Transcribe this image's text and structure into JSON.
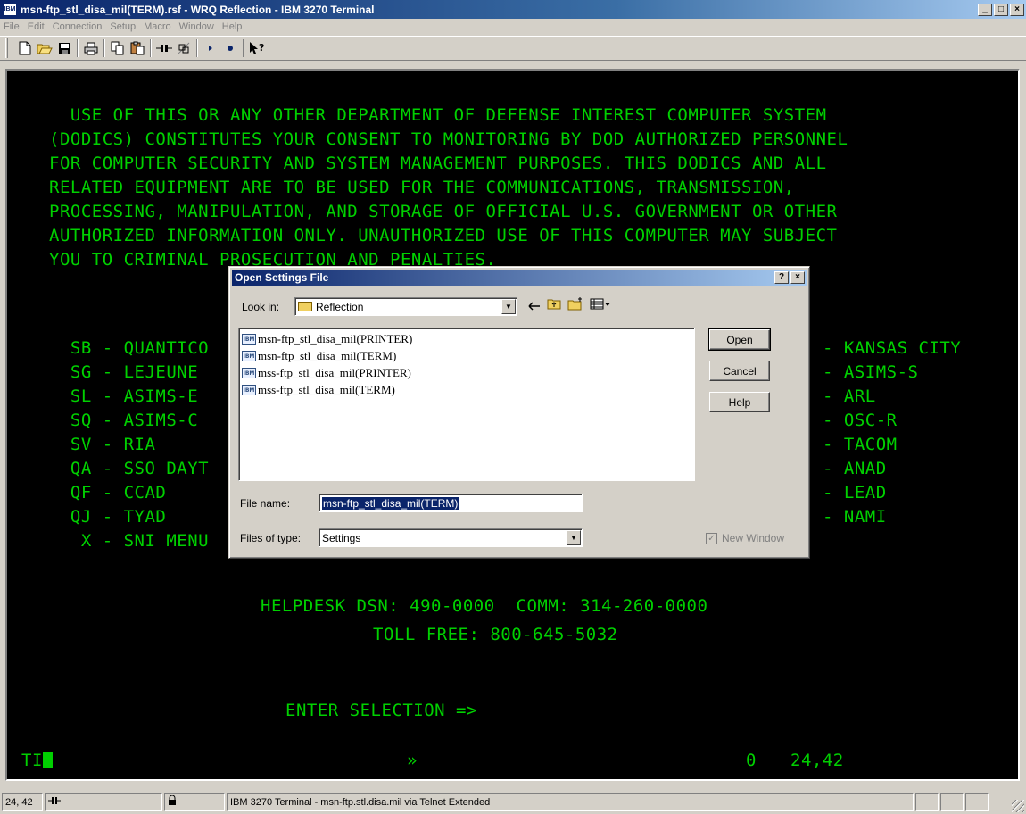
{
  "window": {
    "app_icon": "IBM",
    "title": "msn-ftp_stl_disa_mil(TERM).rsf - WRQ Reflection - IBM 3270 Terminal",
    "min_label": "_",
    "max_label": "□",
    "close_label": "×"
  },
  "menu": [
    "File",
    "Edit",
    "Connection",
    "Setup",
    "Macro",
    "Window",
    "Help"
  ],
  "toolbar": {
    "icons": [
      "new-icon",
      "open-icon",
      "save-icon",
      "print-icon",
      "copy-icon",
      "paste-icon",
      "connect-icon",
      "disconnect-icon",
      "play-macro-icon",
      "record-macro-icon",
      "context-help-icon"
    ]
  },
  "terminal": {
    "banner": [
      "  USE OF THIS OR ANY OTHER DEPARTMENT OF DEFENSE INTEREST COMPUTER SYSTEM",
      "(DODICS) CONSTITUTES YOUR CONSENT TO MONITORING BY DOD AUTHORIZED PERSONNEL",
      "FOR COMPUTER SECURITY AND SYSTEM MANAGEMENT PURPOSES. THIS DODICS AND ALL",
      "RELATED EQUIPMENT ARE TO BE USED FOR THE COMMUNICATIONS, TRANSMISSION,",
      "PROCESSING, MANIPULATION, AND STORAGE OF OFFICIAL U.S. GOVERNMENT OR OTHER",
      "AUTHORIZED INFORMATION ONLY. UNAUTHORIZED USE OF THIS COMPUTER MAY SUBJECT",
      "YOU TO CRIMINAL PROSECUTION AND PENALTIES."
    ],
    "left_menu": [
      "  SB - QUANTICO",
      "  SG - LEJEUNE",
      "  SL - ASIMS-E",
      "  SQ - ASIMS-C",
      "  SV - RIA",
      "  QA - SSO DAYT",
      "  QF - CCAD",
      "  QJ - TYAD",
      "   X - SNI MENU"
    ],
    "right_menu": [
      "- KANSAS CITY",
      "- ASIMS-S",
      "- ARL",
      "- OSC-R",
      "- TACOM",
      "- ANAD",
      "- LEAD",
      "- NAMI"
    ],
    "helpdesk": "HELPDESK DSN: 490-0000  COMM: 314-260-0000",
    "tollfree": "TOLL FREE: 800-645-5032",
    "prompt": "ENTER SELECTION =>",
    "status_left": "TI",
    "status_mid": "»",
    "status_o": "0",
    "status_pos": "24,42"
  },
  "dialog": {
    "title": "Open Settings File",
    "help_btn": "?",
    "close_btn": "×",
    "look_in_label": "Look in:",
    "look_in_value": "Reflection",
    "files": [
      "msn-ftp_stl_disa_mil(PRINTER)",
      "msn-ftp_stl_disa_mil(TERM)",
      "mss-ftp_stl_disa_mil(PRINTER)",
      "mss-ftp_stl_disa_mil(TERM)"
    ],
    "file_icon_text": "IBM",
    "file_name_label": "File name:",
    "file_name_value": "msn-ftp_stl_disa_mil(TERM)",
    "files_of_type_label": "Files of type:",
    "files_of_type_value": "Settings",
    "open_btn": "Open",
    "cancel_btn": "Cancel",
    "help_button": "Help",
    "new_window_label": "New Window"
  },
  "statusbar": {
    "cursor_pos": "24, 42",
    "description": "IBM 3270 Terminal - msn-ftp.stl.disa.mil via Telnet Extended"
  }
}
